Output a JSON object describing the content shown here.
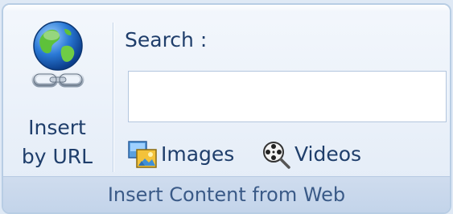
{
  "ribbon_group": {
    "title": "Insert Content from Web",
    "insert_by_url": {
      "line1": "Insert",
      "line2": "by URL",
      "icon": "globe-link-icon"
    },
    "search": {
      "label": "Search :",
      "value": "",
      "placeholder": ""
    },
    "buttons": [
      {
        "label": "Images",
        "icon": "images-icon"
      },
      {
        "label": "Videos",
        "icon": "videos-icon"
      }
    ]
  }
}
